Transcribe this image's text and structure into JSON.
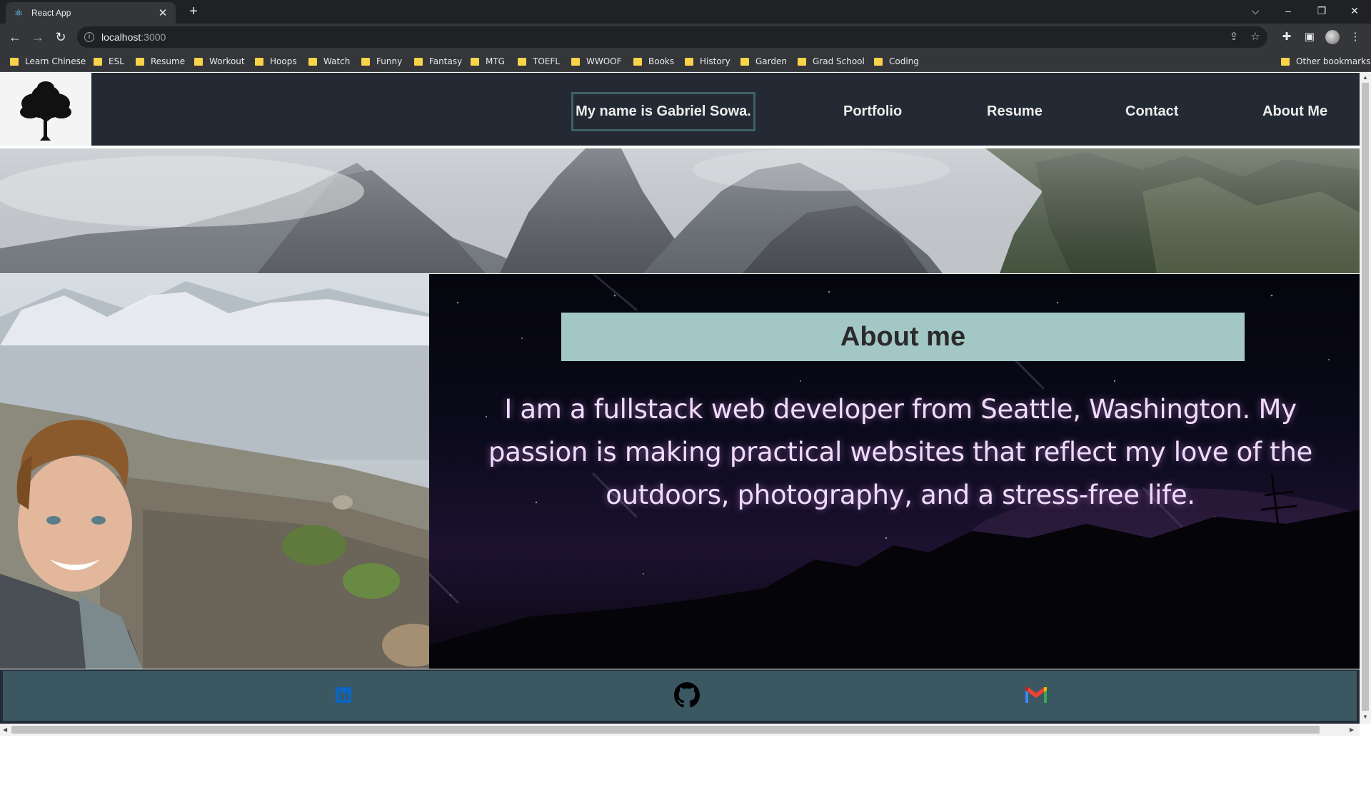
{
  "browser": {
    "tab_title": "React App",
    "tab_close": "✕",
    "new_tab": "+",
    "url_host": "localhost",
    "url_port": ":3000",
    "bookmarks": [
      "Learn Chinese",
      "ESL",
      "Resume",
      "Workout",
      "Hoops",
      "Watch",
      "Funny",
      "Fantasy",
      "MTG",
      "TOEFL",
      "WWOOF",
      "Books",
      "History",
      "Garden",
      "Grad School",
      "Coding"
    ],
    "other_bookmarks": "Other bookmarks"
  },
  "header": {
    "name_button": "My name is Gabriel Sowa.",
    "nav": [
      "Portfolio",
      "Resume",
      "Contact",
      "About Me"
    ]
  },
  "about": {
    "title": "About me",
    "text": "I am a fullstack web developer from Seattle, Washington. My passion is making practical websites that reflect my love of the outdoors, photography, and a stress-free life."
  },
  "colors": {
    "header_bg": "#232a33",
    "title_box": "#a3c7c5",
    "footer_bg": "#3a5762",
    "linkedin": "#0a66c2"
  },
  "icons": [
    "react-icon",
    "info-icon",
    "linkedin-icon",
    "github-icon",
    "gmail-icon",
    "tree-logo-icon"
  ]
}
